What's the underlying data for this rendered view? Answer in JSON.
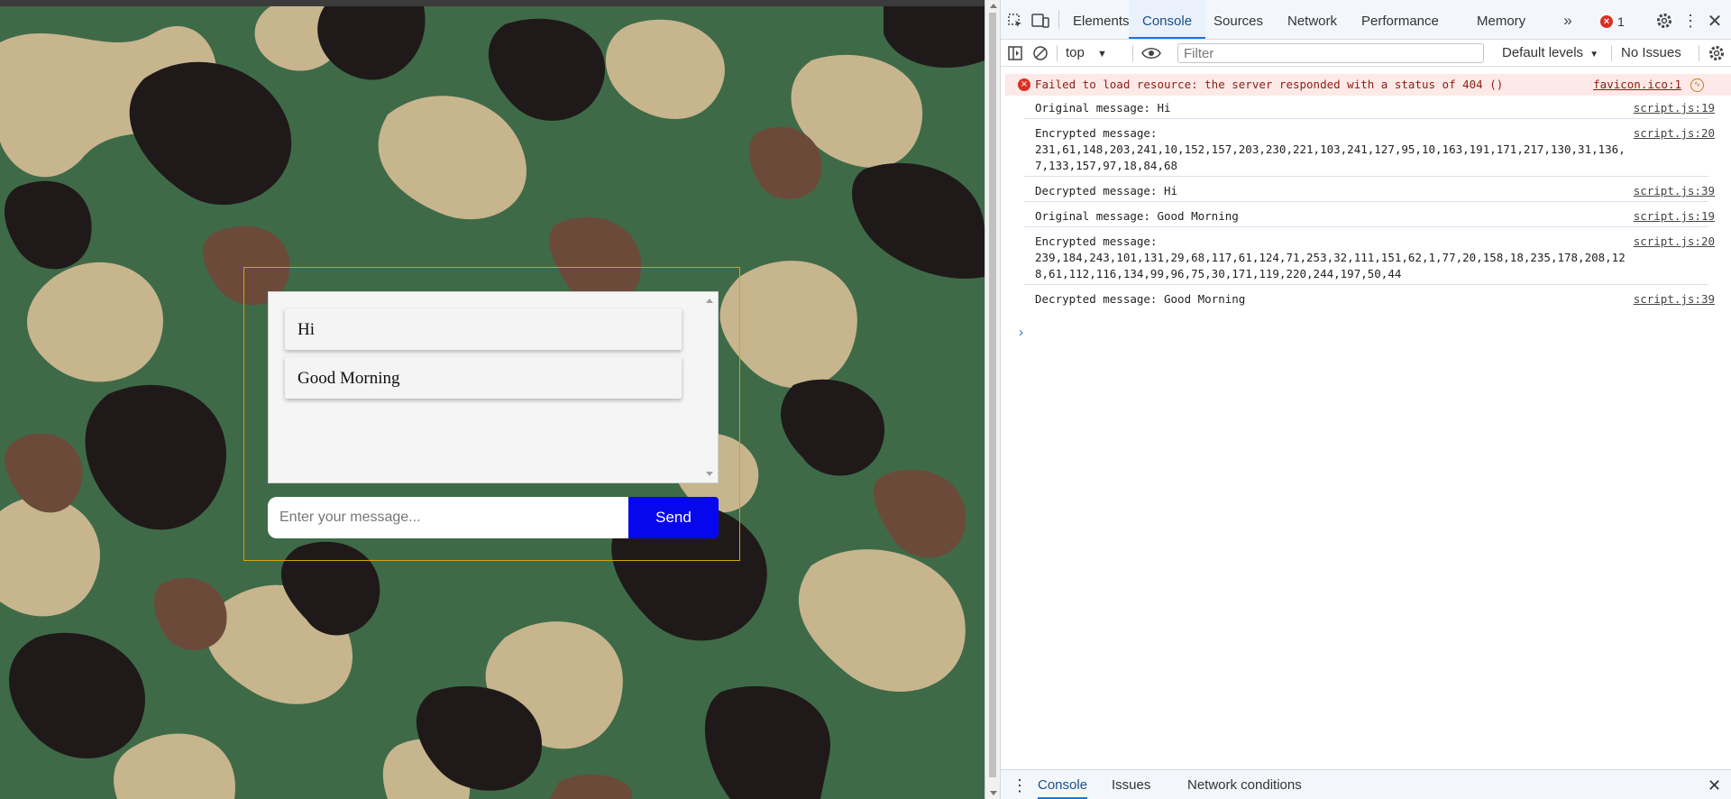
{
  "page": {
    "chat": {
      "messages": [
        "Hi",
        "Good Morning"
      ],
      "input_placeholder": "Enter your message...",
      "send_label": "Send"
    }
  },
  "devtools": {
    "tabs": [
      "Elements",
      "Console",
      "Sources",
      "Network",
      "Performance",
      "Memory"
    ],
    "active_tab": "Console",
    "more_tabs_icon": "chevrons-right-icon",
    "error_count": "1",
    "toolbar": {
      "context": "top",
      "filter_placeholder": "Filter",
      "levels": "Default levels",
      "issues": "No Issues"
    },
    "console_messages": [
      {
        "level": "error",
        "text": "Failed to load resource: the server responded with a status of 404 ()",
        "source": "favicon.ico:1"
      },
      {
        "level": "log",
        "text": "Original message: Hi",
        "source": "script.js:19"
      },
      {
        "level": "log",
        "text": "Encrypted message:\n231,61,148,203,241,10,152,157,203,230,221,103,241,127,95,10,163,191,171,217,130,31,136,7,133,157,97,18,84,68",
        "source": "script.js:20"
      },
      {
        "level": "log",
        "text": "Decrypted message: Hi",
        "source": "script.js:39"
      },
      {
        "level": "log",
        "text": "Original message: Good Morning",
        "source": "script.js:19"
      },
      {
        "level": "log",
        "text": "Encrypted message:\n239,184,243,101,131,29,68,117,61,124,71,253,32,111,151,62,1,77,20,158,18,235,178,208,128,61,112,116,134,99,96,75,30,171,119,220,244,197,50,44",
        "source": "script.js:20"
      },
      {
        "level": "log",
        "text": "Decrypted message: Good Morning",
        "source": "script.js:39"
      }
    ],
    "drawer_tabs": [
      "Console",
      "Issues",
      "Network conditions"
    ],
    "colors": {
      "accent": "#1a73e8",
      "error": "#d93025",
      "send_button": "#0707ee"
    }
  }
}
